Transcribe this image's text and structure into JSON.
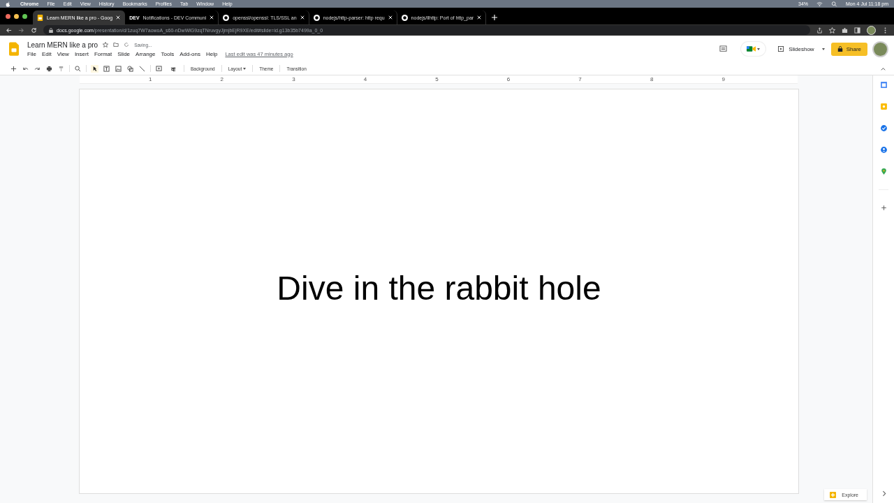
{
  "menubar": {
    "app": "Chrome",
    "items": [
      "File",
      "Edit",
      "View",
      "History",
      "Bookmarks",
      "Profiles",
      "Tab",
      "Window",
      "Help"
    ],
    "battery": "34%",
    "clock": "Mon 4 Jul  11:18 pm"
  },
  "tabs": [
    {
      "title": "Learn MERN like a pro - Goog",
      "selected": true,
      "kind": "slides"
    },
    {
      "title": "Notifications - DEV Communi",
      "selected": false,
      "kind": "dev",
      "badge": "DEV"
    },
    {
      "title": "openssl/openssl: TLS/SSL an",
      "selected": false,
      "kind": "github"
    },
    {
      "title": "nodejs/http-parser: http requ",
      "selected": false,
      "kind": "github"
    },
    {
      "title": "nodejs/llhttp: Port of http_par",
      "selected": false,
      "kind": "github"
    }
  ],
  "address": {
    "host": "docs.google.com",
    "path": "/presentation/d/1zuq7W7aowoA_s60-nDwWlG9zqTNruvgyJjmjbEjR9XE/edit#slide=id.g13b35b7499a_0_0"
  },
  "doc": {
    "title": "Learn MERN like a pro",
    "status": "Saving...",
    "menus": [
      "File",
      "Edit",
      "View",
      "Insert",
      "Format",
      "Slide",
      "Arrange",
      "Tools",
      "Add-ons",
      "Help"
    ],
    "last_edit": "Last edit was 47 minutes ago",
    "slideshow": "Slideshow",
    "share": "Share"
  },
  "toolbar": {
    "glyph": "वा",
    "buttons": [
      {
        "label": "Background",
        "dropdown": false
      },
      {
        "label": "Layout",
        "dropdown": true
      },
      {
        "label": "Theme",
        "dropdown": false
      },
      {
        "label": "Transition",
        "dropdown": false
      }
    ]
  },
  "ruler": [
    "1",
    "2",
    "3",
    "4",
    "5",
    "6",
    "7",
    "8",
    "9"
  ],
  "slide": {
    "text": "Dive in the rabbit hole"
  },
  "explore": "Explore"
}
